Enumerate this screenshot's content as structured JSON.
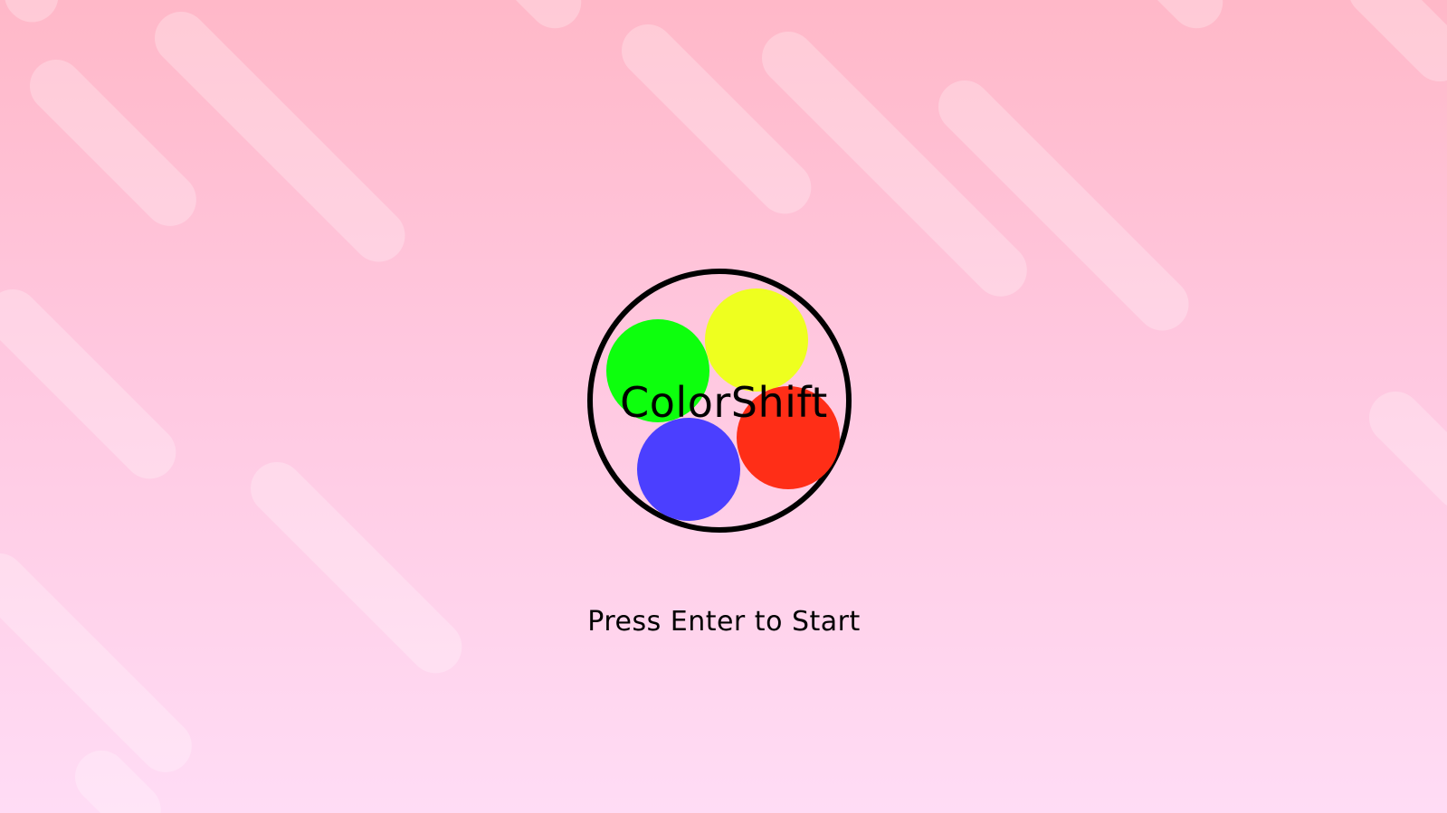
{
  "game": {
    "title": "ColorShift",
    "prompt": "Press Enter to Start"
  },
  "colors": {
    "background_top": "#ffb8c8",
    "background_bottom": "#ffdcf5",
    "ball_green": "#0dff0d",
    "ball_yellow": "#eeff1f",
    "ball_red": "#ff2e17",
    "ball_blue": "#4b3fff",
    "logo_ring": "#000000"
  }
}
